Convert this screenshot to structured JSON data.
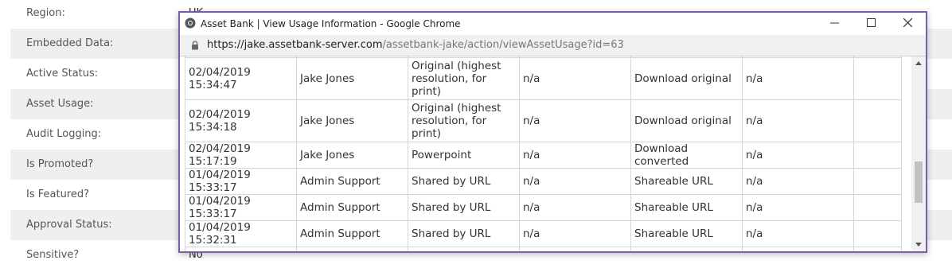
{
  "background": {
    "rows": [
      {
        "label": "Region:",
        "value": "UK"
      },
      {
        "label": "Embedded Data:",
        "value": ""
      },
      {
        "label": "Active Status:",
        "value": ""
      },
      {
        "label": "Asset Usage:",
        "value": ""
      },
      {
        "label": "Audit Logging:",
        "value": ""
      },
      {
        "label": "Is Promoted?",
        "value": ""
      },
      {
        "label": "Is Featured?",
        "value": ""
      },
      {
        "label": "Approval Status:",
        "value": ""
      },
      {
        "label": "Sensitive?",
        "value": "No"
      }
    ]
  },
  "popup": {
    "title": "Asset Bank | View Usage Information - Google Chrome",
    "url_host": "https://jake.assetbank-server.com",
    "url_path": "/assetbank-jake/action/viewAssetUsage?id=63",
    "border_color": "#7b5ea7",
    "icons": {
      "browser": "chrome-icon",
      "lock": "lock-icon",
      "minimize": "minimize-icon",
      "maximize": "maximize-icon",
      "close": "close-icon"
    },
    "rows": [
      {
        "date": "02/04/2019 15:34:47",
        "user": "Jake Jones",
        "type": "Original (highest resolution, for print)",
        "c4": "n/a",
        "action": "Download original",
        "c6": "n/a",
        "c7": ""
      },
      {
        "date": "02/04/2019 15:34:18",
        "user": "Jake Jones",
        "type": "Original (highest resolution, for print)",
        "c4": "n/a",
        "action": "Download original",
        "c6": "n/a",
        "c7": ""
      },
      {
        "date": "02/04/2019 15:17:19",
        "user": "Jake Jones",
        "type": "Powerpoint",
        "c4": "n/a",
        "action": "Download converted",
        "c6": "n/a",
        "c7": ""
      },
      {
        "date": "01/04/2019 15:33:17",
        "user": "Admin Support",
        "type": "Shared by URL",
        "c4": "n/a",
        "action": "Shareable URL",
        "c6": "n/a",
        "c7": ""
      },
      {
        "date": "01/04/2019 15:33:17",
        "user": "Admin Support",
        "type": "Shared by URL",
        "c4": "n/a",
        "action": "Shareable URL",
        "c6": "n/a",
        "c7": ""
      },
      {
        "date": "01/04/2019 15:32:31",
        "user": "Admin Support",
        "type": "Shared by URL",
        "c4": "n/a",
        "action": "Shareable URL",
        "c6": "n/a",
        "c7": ""
      }
    ]
  }
}
